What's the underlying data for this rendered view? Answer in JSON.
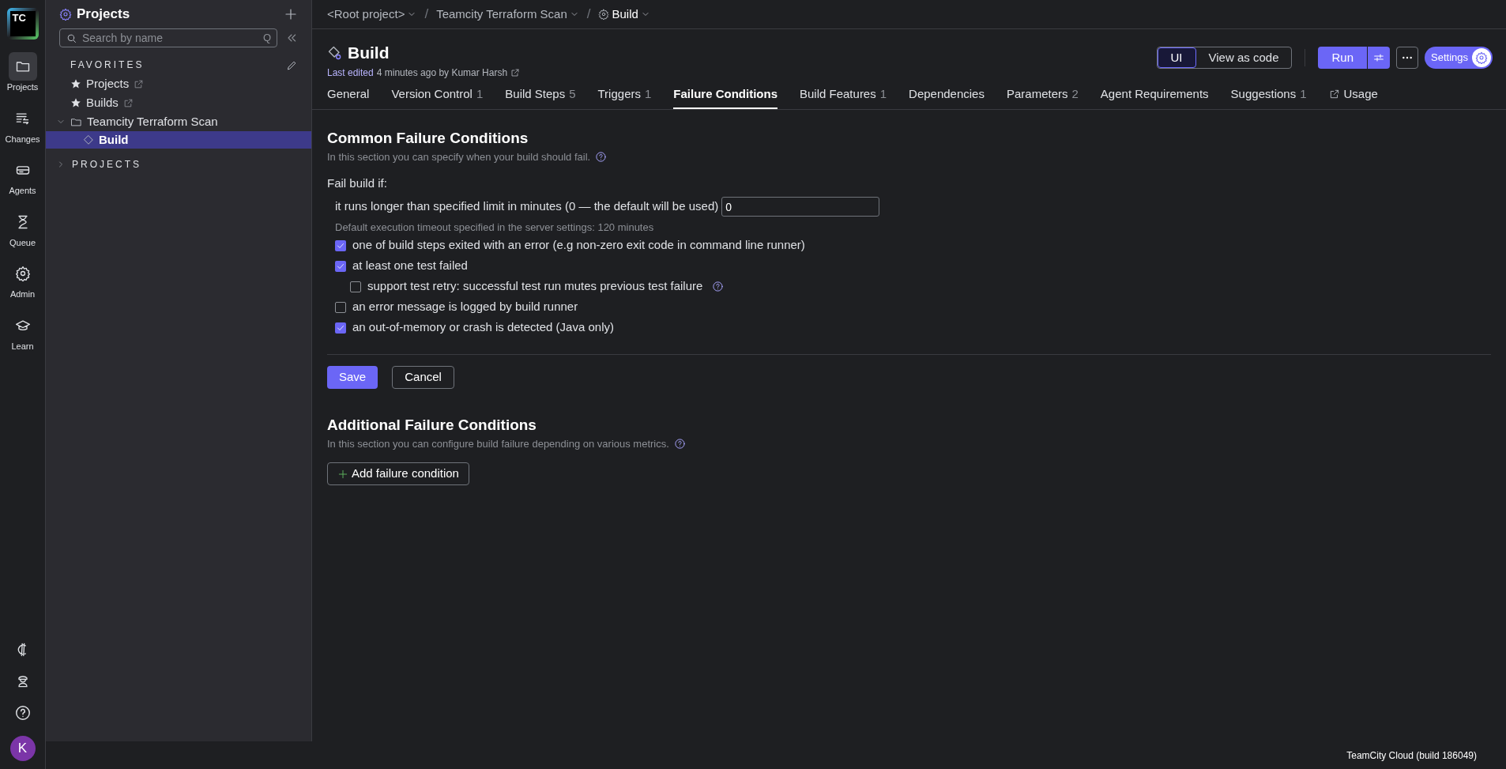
{
  "rail": {
    "logo": "TC",
    "items": [
      {
        "label": "Projects",
        "selected": true,
        "kind": "folder"
      },
      {
        "label": "Changes",
        "selected": false,
        "kind": "changes"
      },
      {
        "label": "Agents",
        "selected": false,
        "kind": "agents"
      },
      {
        "label": "Queue",
        "selected": false,
        "kind": "queue"
      },
      {
        "label": "Admin",
        "selected": false,
        "kind": "admin"
      },
      {
        "label": "Learn",
        "selected": false,
        "kind": "learn"
      }
    ],
    "avatar": "K"
  },
  "sidebar": {
    "title": "Projects",
    "search": {
      "placeholder": "Search by name",
      "shortcut": "Q"
    },
    "favorites_heading": "FAVORITES",
    "favorites": [
      {
        "label": "Projects"
      },
      {
        "label": "Builds"
      }
    ],
    "tree": [
      {
        "label": "Teamcity Terraform Scan",
        "expanded": true,
        "selected": false,
        "children": [
          {
            "label": "Build",
            "selected": true
          }
        ]
      }
    ],
    "projects_heading": "PROJECTS",
    "projects_expanded": false
  },
  "breadcrumbs": [
    {
      "label": "<Root project>",
      "icon": false
    },
    {
      "separator": "/",
      "label": "Teamcity Terraform Scan",
      "icon": false
    },
    {
      "separator": "/",
      "label": "Build",
      "icon": true
    }
  ],
  "header": {
    "title": "Build",
    "edited_link": "Last edited",
    "edited_rest": "4 minutes ago by Kumar Harsh",
    "view_toggle": [
      {
        "label": "UI",
        "selected": true
      },
      {
        "label": "View as code",
        "selected": false
      }
    ],
    "run": "Run",
    "settings": "Settings"
  },
  "tabs": [
    {
      "label": "General",
      "selected": false,
      "kind": "plain"
    },
    {
      "label": "Version Control",
      "count": "1",
      "selected": false,
      "kind": "plain"
    },
    {
      "label": "Build Steps",
      "count": "5",
      "selected": false,
      "kind": "plain"
    },
    {
      "label": "Triggers",
      "count": "1",
      "selected": false,
      "kind": "plain"
    },
    {
      "label": "Failure Conditions",
      "selected": true,
      "kind": "plain"
    },
    {
      "label": "Build Features",
      "count": "1",
      "selected": false,
      "kind": "plain"
    },
    {
      "label": "Dependencies",
      "selected": false,
      "kind": "plain"
    },
    {
      "label": "Parameters",
      "count": "2",
      "selected": false,
      "kind": "plain"
    },
    {
      "label": "Agent Requirements",
      "selected": false,
      "kind": "plain"
    },
    {
      "label": "Suggestions",
      "count": "1",
      "selected": false,
      "kind": "plain"
    },
    {
      "label": "Usage",
      "selected": false,
      "kind": "external"
    }
  ],
  "common": {
    "title": "Common Failure Conditions",
    "description": "In this section you can specify when your build should fail.",
    "fail_label": "Fail build if:",
    "timeout": {
      "label": "it runs longer than specified limit in minutes (0 — the default will be used)",
      "value": "0",
      "hint": "Default execution timeout specified in the server settings: 120 minutes"
    },
    "conditions": [
      {
        "label": "one of build steps exited with an error (e.g non-zero exit code in command line runner)",
        "checked": true
      },
      {
        "label": "at least one test failed",
        "checked": true,
        "children": [
          {
            "label": "support test retry: successful test run mutes previous test failure",
            "checked": false,
            "help": true
          }
        ]
      },
      {
        "label": "an error message is logged by build runner",
        "checked": false
      },
      {
        "label": "an out-of-memory or crash is detected (Java only)",
        "checked": true
      }
    ],
    "buttons": [
      "Save",
      "Cancel"
    ]
  },
  "additional": {
    "title": "Additional Failure Conditions",
    "description": "In this section you can configure build failure depending on various metrics.",
    "add_button": "Add failure condition"
  },
  "footer": "TeamCity Cloud (build 186049)"
}
